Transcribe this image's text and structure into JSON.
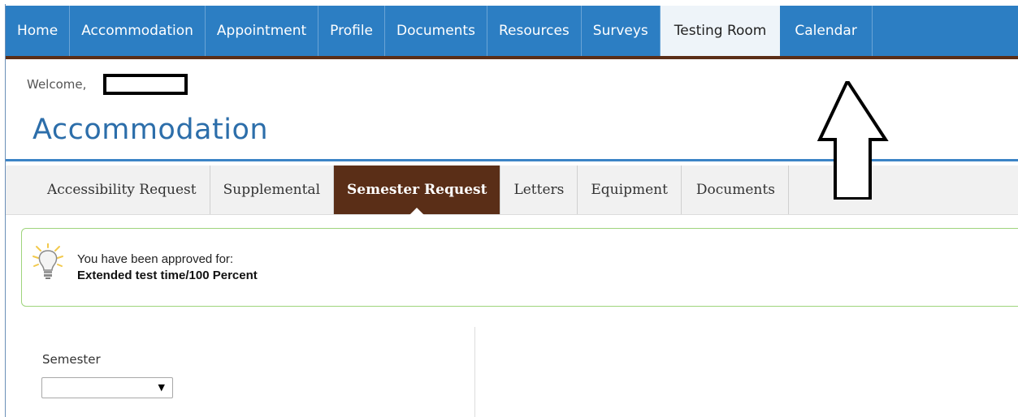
{
  "topnav": {
    "items": [
      {
        "label": "Home"
      },
      {
        "label": "Accommodation"
      },
      {
        "label": "Appointment"
      },
      {
        "label": "Profile"
      },
      {
        "label": "Documents"
      },
      {
        "label": "Resources"
      },
      {
        "label": "Surveys"
      },
      {
        "label": "Testing Room"
      },
      {
        "label": "Calendar"
      }
    ],
    "active_index": 7
  },
  "welcome": {
    "text": "Welcome,"
  },
  "page": {
    "title": "Accommodation"
  },
  "subnav": {
    "tabs": [
      {
        "label": "Accessibility Request"
      },
      {
        "label": "Supplemental"
      },
      {
        "label": "Semester Request"
      },
      {
        "label": "Letters"
      },
      {
        "label": "Equipment"
      },
      {
        "label": "Documents"
      }
    ],
    "active_index": 2
  },
  "notice": {
    "line1": "You have been approved for:",
    "line2": "Extended test time/100 Percent",
    "icon": "lightbulb-icon"
  },
  "semester": {
    "label": "Semester",
    "selected": ""
  },
  "colors": {
    "nav_blue": "#2c7ec3",
    "brown": "#5a2e17",
    "title_blue": "#2c6eaa",
    "notice_border": "#9ed47c"
  }
}
